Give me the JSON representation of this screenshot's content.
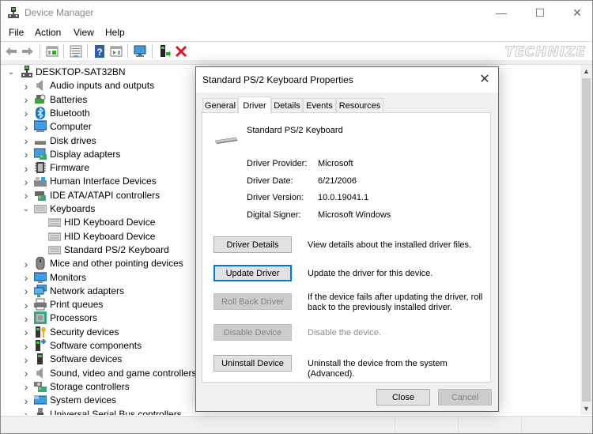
{
  "window": {
    "title": "Device Manager",
    "controls": {
      "minimize": "—",
      "maximize": "☐",
      "close": "✕"
    }
  },
  "menu": [
    "File",
    "Action",
    "View",
    "Help"
  ],
  "toolbar": {
    "icons": [
      "back-arrow-icon",
      "forward-arrow-icon",
      "show-hide-console-tree-icon",
      "properties-icon",
      "help-icon",
      "action-pane-icon",
      "scan-hardware-icon",
      "update-driver-icon",
      "uninstall-device-icon"
    ]
  },
  "watermark": "TECHNIZE",
  "tree": {
    "root": "DESKTOP-SAT32BN",
    "categories": [
      {
        "label": "Audio inputs and outputs",
        "icon": "speaker-icon",
        "expanded": false
      },
      {
        "label": "Batteries",
        "icon": "battery-icon",
        "expanded": false
      },
      {
        "label": "Bluetooth",
        "icon": "bluetooth-icon",
        "expanded": false
      },
      {
        "label": "Computer",
        "icon": "computer-icon",
        "expanded": false
      },
      {
        "label": "Disk drives",
        "icon": "disk-drive-icon",
        "expanded": false
      },
      {
        "label": "Display adapters",
        "icon": "display-adapter-icon",
        "expanded": false
      },
      {
        "label": "Firmware",
        "icon": "firmware-icon",
        "expanded": false
      },
      {
        "label": "Human Interface Devices",
        "icon": "hid-icon",
        "expanded": false
      },
      {
        "label": "IDE ATA/ATAPI controllers",
        "icon": "ide-controller-icon",
        "expanded": false
      },
      {
        "label": "Keyboards",
        "icon": "keyboard-icon",
        "expanded": true,
        "children": [
          "HID Keyboard Device",
          "HID Keyboard Device",
          "Standard PS/2 Keyboard"
        ]
      },
      {
        "label": "Mice and other pointing devices",
        "icon": "mouse-icon",
        "expanded": false
      },
      {
        "label": "Monitors",
        "icon": "monitor-icon",
        "expanded": false
      },
      {
        "label": "Network adapters",
        "icon": "network-adapter-icon",
        "expanded": false
      },
      {
        "label": "Print queues",
        "icon": "printer-icon",
        "expanded": false
      },
      {
        "label": "Processors",
        "icon": "processor-icon",
        "expanded": false
      },
      {
        "label": "Security devices",
        "icon": "security-device-icon",
        "expanded": false
      },
      {
        "label": "Software components",
        "icon": "software-component-icon",
        "expanded": false
      },
      {
        "label": "Software devices",
        "icon": "software-device-icon",
        "expanded": false
      },
      {
        "label": "Sound, video and game controllers",
        "icon": "sound-controller-icon",
        "expanded": false
      },
      {
        "label": "Storage controllers",
        "icon": "storage-controller-icon",
        "expanded": false
      },
      {
        "label": "System devices",
        "icon": "system-device-icon",
        "expanded": false
      },
      {
        "label": "Universal Serial Bus controllers",
        "icon": "usb-icon",
        "expanded": false
      }
    ]
  },
  "dialog": {
    "title": "Standard PS/2 Keyboard Properties",
    "tabs": [
      "General",
      "Driver",
      "Details",
      "Events",
      "Resources"
    ],
    "active_tab": "Driver",
    "device_name": "Standard PS/2 Keyboard",
    "properties": [
      {
        "label": "Driver Provider:",
        "value": "Microsoft"
      },
      {
        "label": "Driver Date:",
        "value": "6/21/2006"
      },
      {
        "label": "Driver Version:",
        "value": "10.0.19041.1"
      },
      {
        "label": "Digital Signer:",
        "value": "Microsoft Windows"
      }
    ],
    "actions": [
      {
        "button": "Driver Details",
        "description": "View details about the installed driver files.",
        "enabled": true,
        "focused": false
      },
      {
        "button": "Update Driver",
        "description": "Update the driver for this device.",
        "enabled": true,
        "focused": true
      },
      {
        "button": "Roll Back Driver",
        "description": "If the device fails after updating the driver, roll back to the previously installed driver.",
        "description_lines": [
          "If the device fails after updating the driver, roll",
          "back to the previously installed driver."
        ],
        "enabled": false,
        "focused": false
      },
      {
        "button": "Disable Device",
        "description": "Disable the device.",
        "enabled": false,
        "focused": false
      },
      {
        "button": "Uninstall Device",
        "description": "Uninstall the device from the system (Advanced).",
        "enabled": true,
        "focused": false
      }
    ],
    "footer": {
      "close": "Close",
      "cancel": "Cancel",
      "cancel_enabled": false
    }
  },
  "colors": {
    "focus_blue": "#0078d7",
    "delete_red": "#e81123",
    "help_blue": "#2b5fb4",
    "bluetooth_blue": "#0a7ce0"
  }
}
